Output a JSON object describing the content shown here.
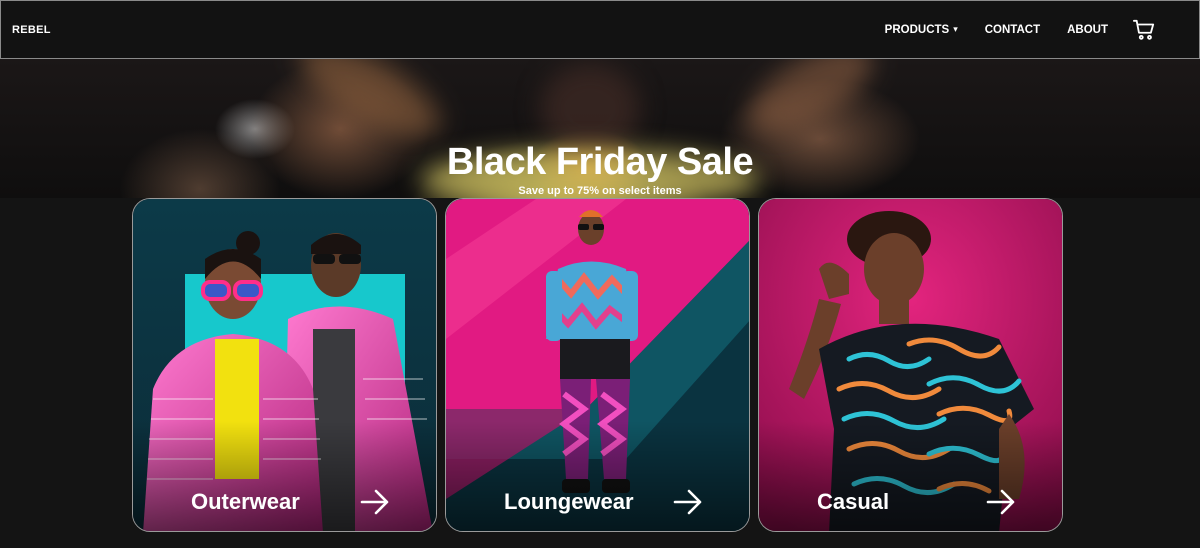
{
  "nav": {
    "brand": "REBEL",
    "links": [
      "PRODUCTS",
      "CONTACT",
      "ABOUT"
    ],
    "products_caret": "▾",
    "cart_icon": "cart-icon"
  },
  "hero": {
    "title": "Black Friday Sale",
    "subtitle": "Save up to 75% on select items"
  },
  "cards": [
    {
      "label": "Outerwear",
      "icon": "arrow-right-icon"
    },
    {
      "label": "Loungewear",
      "icon": "arrow-right-icon"
    },
    {
      "label": "Casual",
      "icon": "arrow-right-icon"
    }
  ],
  "colors": {
    "background": "#141414",
    "navbar": "#121212",
    "magenta": "#e0127a",
    "teal": "#0e4a57"
  }
}
